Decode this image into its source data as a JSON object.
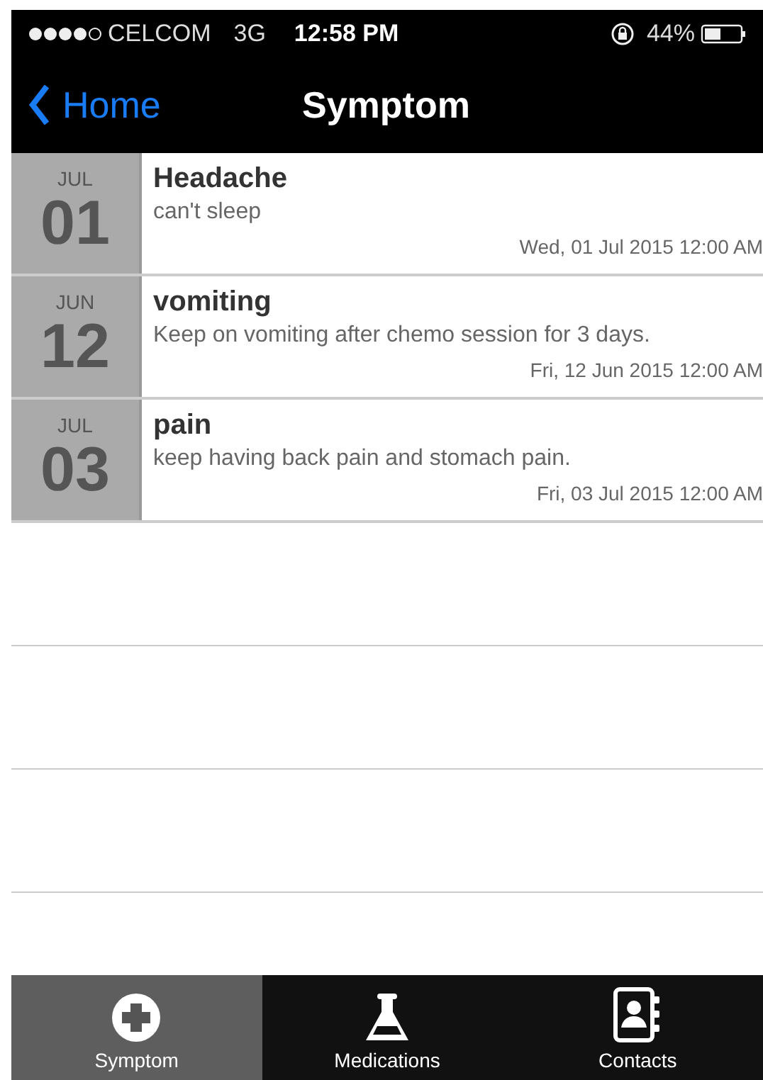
{
  "status_bar": {
    "carrier": "CELCOM",
    "network": "3G",
    "time": "12:58 PM",
    "battery": "44%"
  },
  "nav": {
    "back": "Home",
    "title": "Symptom"
  },
  "entries": [
    {
      "month": "JUL",
      "day": "01",
      "title": "Headache",
      "note": "can't sleep",
      "date": "Wed, 01 Jul 2015 12:00 AM"
    },
    {
      "month": "JUN",
      "day": "12",
      "title": "vomiting",
      "note": "Keep on vomiting after chemo session for 3 days.",
      "date": "Fri, 12 Jun 2015 12:00 AM"
    },
    {
      "month": "JUL",
      "day": "03",
      "title": "pain",
      "note": "keep having back pain and stomach pain.",
      "date": "Fri, 03 Jul 2015 12:00 AM"
    }
  ],
  "tabs": [
    {
      "kind": "plus",
      "label": "Symptom",
      "selected": true
    },
    {
      "kind": "flask",
      "label": "Medications",
      "selected": false
    },
    {
      "kind": "contacts",
      "label": "Contacts",
      "selected": false
    }
  ]
}
